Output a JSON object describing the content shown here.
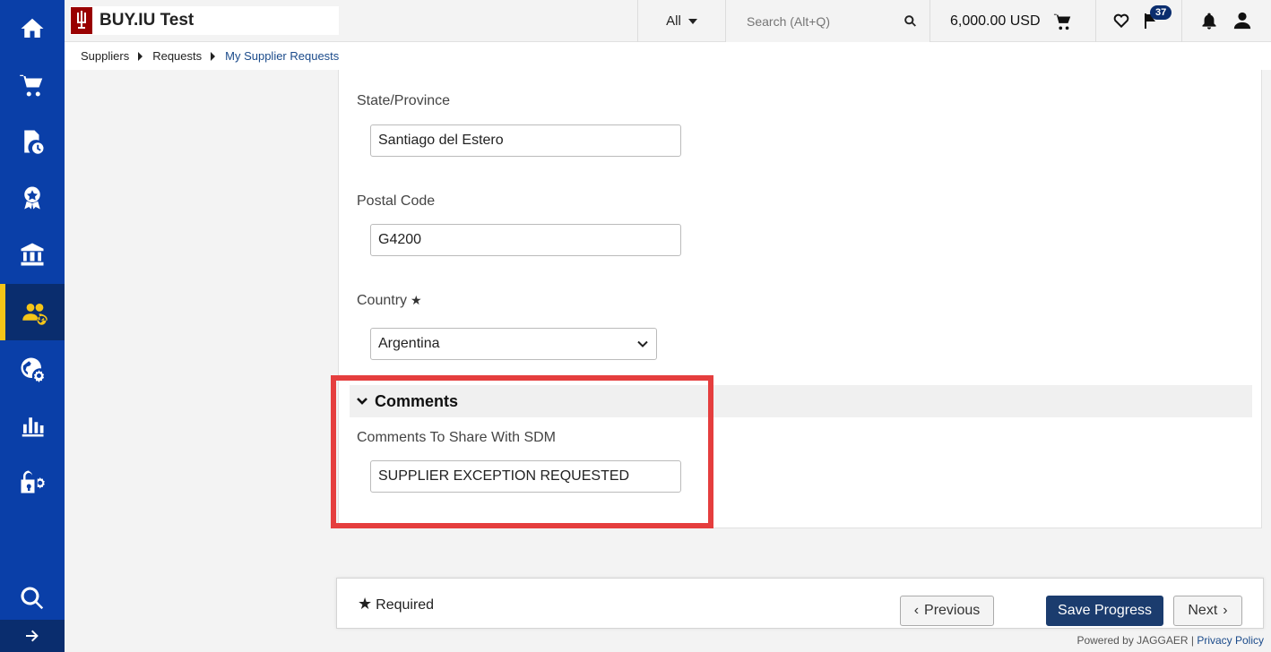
{
  "header": {
    "logo_text": "BUY.IU Test",
    "scope_select": "All",
    "search_placeholder": "Search (Alt+Q)",
    "cart_total": "6,000.00 USD",
    "notification_count": "37"
  },
  "breadcrumb": {
    "items": [
      "Suppliers",
      "Requests",
      "My Supplier Requests"
    ]
  },
  "form": {
    "state_label": "State/Province",
    "state_value": "Santiago del Estero",
    "postal_label": "Postal Code",
    "postal_value": "G4200",
    "country_label": "Country",
    "country_value": "Argentina",
    "comments_section_title": "Comments",
    "comments_label": "Comments To Share With SDM",
    "comments_value": "SUPPLIER EXCEPTION REQUESTED"
  },
  "footer": {
    "required_note": "Required",
    "previous_label": "Previous",
    "save_label": "Save Progress",
    "next_label": "Next",
    "powered_by": "Powered by JAGGAER",
    "privacy_link": "Privacy Policy"
  },
  "colors": {
    "nav_bg": "#0a3fa8",
    "nav_active": "#0a2d6e",
    "accent_yellow": "#f5c518",
    "primary_button": "#1b3c6e",
    "highlight_red": "#e53e3e",
    "iu_crimson": "#990000"
  },
  "nav_icons": [
    "home-icon",
    "cart-icon",
    "document-clock-icon",
    "award-icon",
    "bank-icon",
    "supplier-group-icon",
    "globe-gear-icon",
    "bar-chart-icon",
    "lock-gear-icon",
    "search-icon"
  ]
}
